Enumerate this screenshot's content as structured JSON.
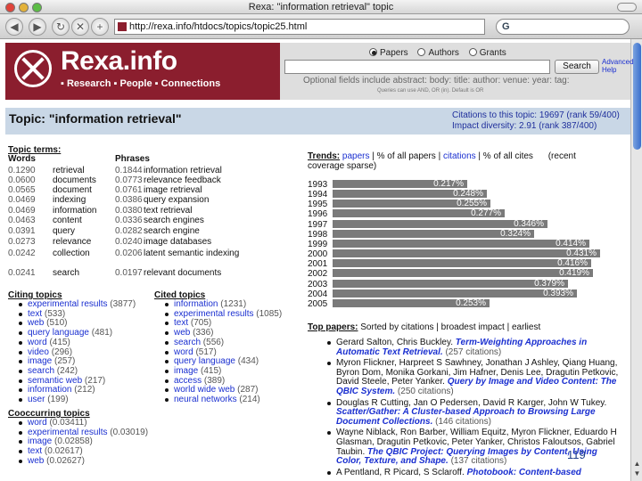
{
  "window": {
    "title": "Rexa: \"information retrieval\" topic"
  },
  "browser": {
    "url": "http://rexa.info/htdocs/topics/topic25.html",
    "search_engine": "G"
  },
  "header": {
    "logo": "Rexa.info",
    "nav": "▪ Research ▪ People ▪ Connections",
    "radios": [
      {
        "label": "Papers",
        "selected": true
      },
      {
        "label": "Authors",
        "selected": false
      },
      {
        "label": "Grants",
        "selected": false
      }
    ],
    "search_button": "Search",
    "advanced_link": "Advanced",
    "help_link": "Help",
    "hint": "Optional fields include abstract: body: title: author: venue: year: tag:",
    "hint_small": "Queries can use AND, OR (in). Default is OR"
  },
  "topic": {
    "title": "Topic: \"information retrieval\"",
    "citations_line": "Citations to this topic: 19697 (rank 59/400)",
    "impact_line": "Impact diversity: 2.91 (rank 387/400)"
  },
  "topic_terms": {
    "heading": "Topic terms:",
    "words_header": "Words",
    "phrases_header": "Phrases",
    "rows": [
      {
        "w_weight": "0.1290",
        "word": "retrieval",
        "p_weight": "0.1844",
        "phrase": "information retrieval"
      },
      {
        "w_weight": "0.0600",
        "word": "documents",
        "p_weight": "0.0773",
        "phrase": "relevance feedback"
      },
      {
        "w_weight": "0.0565",
        "word": "document",
        "p_weight": "0.0761",
        "phrase": "image retrieval"
      },
      {
        "w_weight": "0.0469",
        "word": "indexing",
        "p_weight": "0.0386",
        "phrase": "query expansion"
      },
      {
        "w_weight": "0.0469",
        "word": "information",
        "p_weight": "0.0380",
        "phrase": "text retrieval"
      },
      {
        "w_weight": "0.0463",
        "word": "content",
        "p_weight": "0.0336",
        "phrase": "search engines"
      },
      {
        "w_weight": "0.0391",
        "word": "query",
        "p_weight": "0.0282",
        "phrase": "search engine"
      },
      {
        "w_weight": "0.0273",
        "word": "relevance",
        "p_weight": "0.0240",
        "phrase": "image databases"
      },
      {
        "w_weight": "0.0242",
        "word": "collection",
        "p_weight": "0.0206",
        "phrase": "latent semantic indexing"
      },
      {
        "w_weight": "0.0241",
        "word": "search",
        "p_weight": "0.0197",
        "phrase": "relevant documents"
      }
    ]
  },
  "citing_topics": {
    "heading": "Citing topics",
    "items": [
      {
        "label": "experimental results",
        "count": "(3877)"
      },
      {
        "label": "text",
        "count": "(533)"
      },
      {
        "label": "web",
        "count": "(510)"
      },
      {
        "label": "query language",
        "count": "(481)"
      },
      {
        "label": "word",
        "count": "(415)"
      },
      {
        "label": "video",
        "count": "(296)"
      },
      {
        "label": "image",
        "count": "(257)"
      },
      {
        "label": "search",
        "count": "(242)"
      },
      {
        "label": "semantic web",
        "count": "(217)"
      },
      {
        "label": "information",
        "count": "(212)"
      },
      {
        "label": "user",
        "count": "(199)"
      }
    ]
  },
  "cited_topics": {
    "heading": "Cited topics",
    "items": [
      {
        "label": "information",
        "count": "(1231)"
      },
      {
        "label": "experimental results",
        "count": "(1085)"
      },
      {
        "label": "text",
        "count": "(705)"
      },
      {
        "label": "web",
        "count": "(336)"
      },
      {
        "label": "search",
        "count": "(556)"
      },
      {
        "label": "word",
        "count": "(517)"
      },
      {
        "label": "query language",
        "count": "(434)"
      },
      {
        "label": "image",
        "count": "(415)"
      },
      {
        "label": "access",
        "count": "(389)"
      },
      {
        "label": "world wide web",
        "count": "(287)"
      },
      {
        "label": "neural networks",
        "count": "(214)"
      }
    ]
  },
  "cooccurring_topics": {
    "heading": "Cooccurring topics",
    "items": [
      {
        "label": "word",
        "count": "(0.03411)"
      },
      {
        "label": "experimental results",
        "count": "(0.03019)"
      },
      {
        "label": "image",
        "count": "(0.02858)"
      },
      {
        "label": "text",
        "count": "(0.02617)"
      },
      {
        "label": "web",
        "count": "(0.02627)"
      }
    ]
  },
  "trends": {
    "label": "Trends:",
    "link_papers": "papers",
    "sep1": " | % of all papers | ",
    "link_citations": "citations",
    "sep2": " | % of all cites",
    "note_recent": "(recent",
    "note_coverage": "coverage sparse)"
  },
  "chart_data": {
    "type": "bar",
    "orientation": "horizontal",
    "categories": [
      "1993",
      "1994",
      "1995",
      "1996",
      "1997",
      "1998",
      "1999",
      "2000",
      "2001",
      "2002",
      "2003",
      "2004",
      "2005"
    ],
    "values": [
      0.217,
      0.248,
      0.255,
      0.277,
      0.346,
      0.324,
      0.414,
      0.431,
      0.416,
      0.419,
      0.379,
      0.393,
      0.253
    ],
    "labels": [
      "0.217%",
      "0.248%",
      "0.255%",
      "0.277%",
      "0.346%",
      "0.324%",
      "0.414%",
      "0.431%",
      "0.416%",
      "0.419%",
      "0.379%",
      "0.393%",
      "0.253%"
    ],
    "xlim": [
      0,
      0.431
    ]
  },
  "top_papers": {
    "label": "Top papers:",
    "sort_text": "Sorted by citations | broadest impact | earliest",
    "items": [
      {
        "authors": "Gerard Salton, Chris Buckley.",
        "title": "Term-Weighting Approaches in Automatic Text Retrieval.",
        "cites": "(257 citations)"
      },
      {
        "authors": "Myron Flickner, Harpreet S Sawhney, Jonathan J Ashley, Qiang Huang, Byron Dom, Monika Gorkani, Jim Hafner, Denis Lee, Dragutin Petkovic, David Steele, Peter Yanker.",
        "title": "Query by Image and Video Content: The QBIC System.",
        "cites": "(250 citations)"
      },
      {
        "authors": "Douglas R Cutting, Jan O Pedersen, David R Karger, John W Tukey.",
        "title": "Scatter/Gather: A Cluster-based Approach to Browsing Large Document Collections.",
        "cites": "(146 citations)"
      },
      {
        "authors": "Wayne Niblack, Ron Barber, William Equitz, Myron Flickner, Eduardo H Glasman, Dragutin Petkovic, Peter Yanker, Christos Faloutsos, Gabriel Taubin.",
        "title": "The QBIC Project: Querying Images by Content, Using Color, Texture, and Shape.",
        "cites": "(137 citations)"
      },
      {
        "authors": "A Pentland, R Picard, S Sclaroff.",
        "title": "Photobook: Content-based",
        "cites": ""
      }
    ]
  },
  "slide": {
    "number": "119"
  }
}
